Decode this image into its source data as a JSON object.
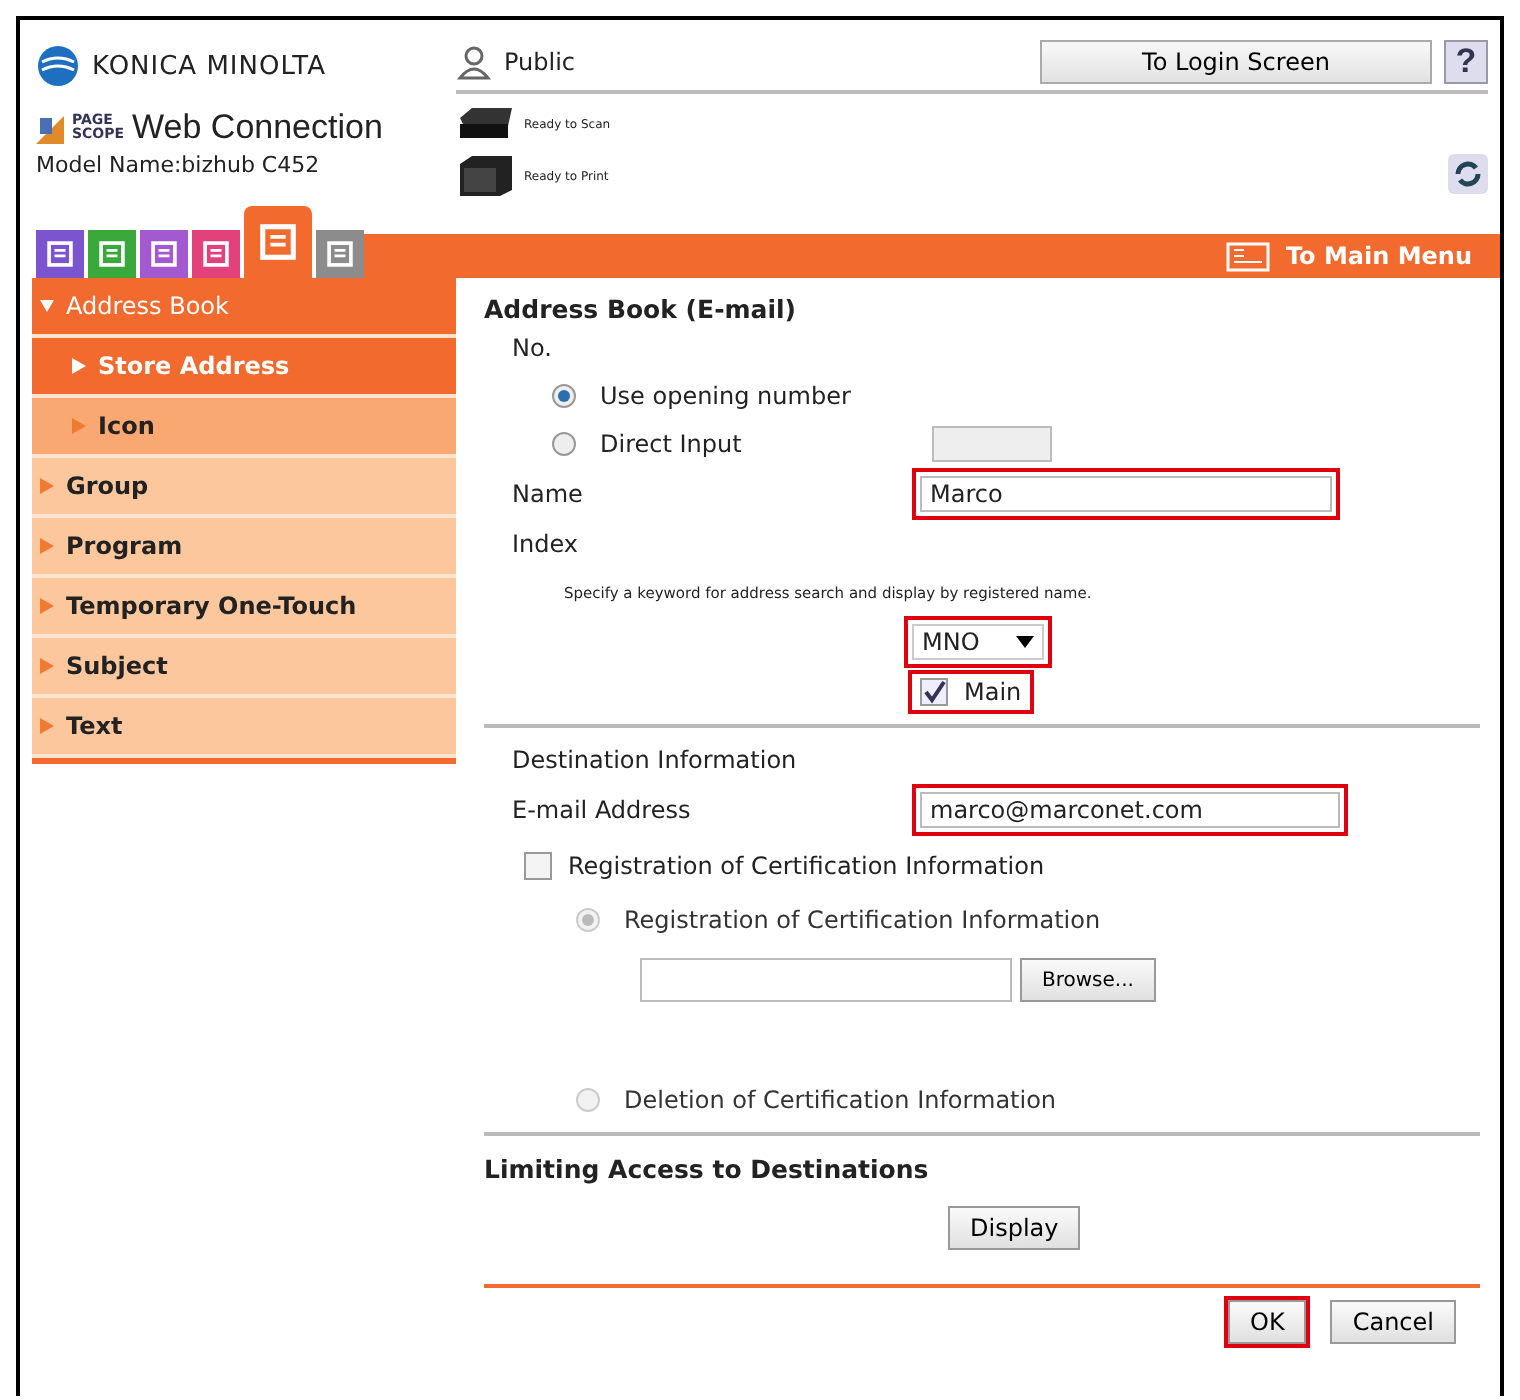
{
  "header": {
    "brand": "KONICA MINOLTA",
    "logo_badge": [
      "PAGE",
      "SCOPE"
    ],
    "product": "Web Connection",
    "model": "Model Name:bizhub C452",
    "user": "Public",
    "login_button": "To Login Screen",
    "help_button": "?",
    "status": [
      {
        "kind": "scanner",
        "text": "Ready to Scan"
      },
      {
        "kind": "printer",
        "text": "Ready to Print"
      }
    ]
  },
  "mode_tabs": [
    {
      "color": "#7b55d0",
      "selected": false
    },
    {
      "color": "#3aa83a",
      "selected": false
    },
    {
      "color": "#a35ad0",
      "selected": false
    },
    {
      "color": "#e2417c",
      "selected": false
    },
    {
      "color": "#f26a2e",
      "selected": true
    },
    {
      "color": "#8c8c8c",
      "selected": false
    }
  ],
  "menu_link": "To Main Menu",
  "sidebar": {
    "items": [
      {
        "label": "Address Book",
        "selected": true,
        "expanded": true,
        "children": [
          {
            "label": "Store Address",
            "selected": true
          },
          {
            "label": "Icon",
            "selected": false
          }
        ]
      },
      {
        "label": "Group",
        "selected": false,
        "expanded": false
      },
      {
        "label": "Program",
        "selected": false,
        "expanded": false
      },
      {
        "label": "Temporary One-Touch",
        "selected": false,
        "expanded": false
      },
      {
        "label": "Subject",
        "selected": false,
        "expanded": false
      },
      {
        "label": "Text",
        "selected": false,
        "expanded": false
      }
    ]
  },
  "form": {
    "title": "Address Book (E-mail)",
    "number": {
      "label": "No.",
      "options": [
        {
          "label": "Use opening number",
          "selected": true
        },
        {
          "label": "Direct Input",
          "selected": false
        }
      ],
      "input_disabled": true
    },
    "name": {
      "label": "Name",
      "value": "Marco",
      "highlighted": true
    },
    "index": {
      "label": "Index",
      "hint": "Specify a keyword for address search and display by registered name.",
      "value": "MNO",
      "highlighted": true,
      "main": {
        "label": "Main",
        "checked": true,
        "highlighted": true
      }
    },
    "destination": {
      "title": "Destination Information",
      "email_label": "E-mail Address",
      "email": "marco@marconet.com",
      "highlighted": true,
      "cert": {
        "label": "Registration of Certification Information",
        "checked": false,
        "options": [
          {
            "label": "Registration of Certification Information",
            "selected": true,
            "disabled": true
          },
          {
            "label": "Deletion of Certification Information",
            "selected": false,
            "disabled": true
          }
        ],
        "browse_button": "Browse..."
      }
    },
    "limiting": {
      "title": "Limiting Access to Destinations",
      "button": "Display"
    },
    "buttons": [
      {
        "label": "OK",
        "highlighted": true
      },
      {
        "label": "Cancel",
        "highlighted": false
      }
    ]
  }
}
